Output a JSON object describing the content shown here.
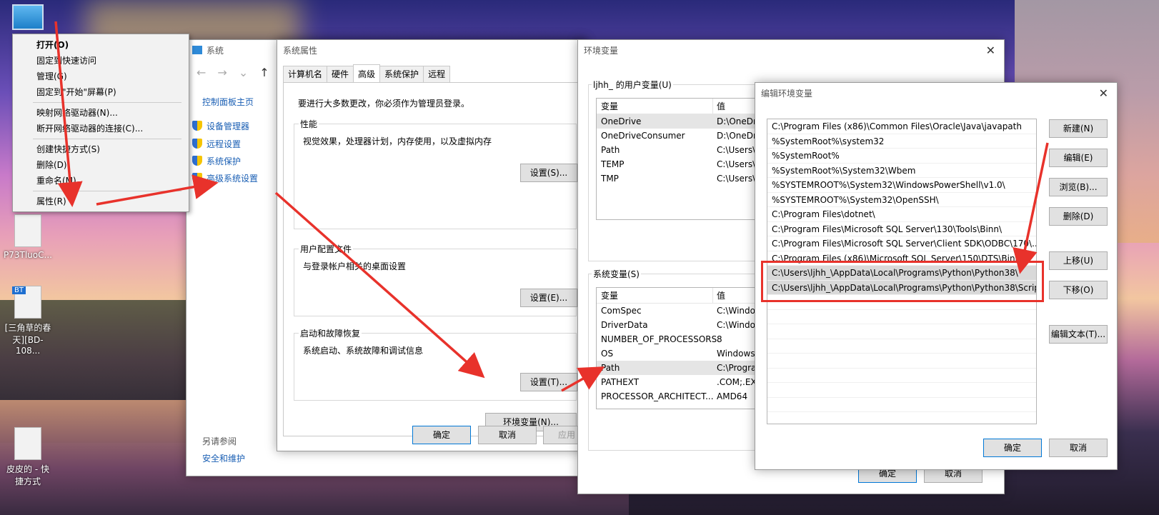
{
  "desktop": {
    "icons": [
      {
        "label": ""
      },
      {
        "label": "P73TluoC..."
      },
      {
        "label": "[三角草的春天][BD-108...",
        "badge": "BT"
      },
      {
        "label": "皮皮的 - 快捷方式"
      }
    ]
  },
  "context_menu": {
    "items": [
      {
        "label": "打开(O)",
        "bold": true
      },
      {
        "label": "固定到快速访问"
      },
      {
        "label": "管理(G)"
      },
      {
        "label": "固定到\"开始\"屏幕(P)"
      },
      {
        "sep": true
      },
      {
        "label": "映射网络驱动器(N)..."
      },
      {
        "label": "断开网络驱动器的连接(C)..."
      },
      {
        "sep": true
      },
      {
        "label": "创建快捷方式(S)"
      },
      {
        "label": "删除(D)"
      },
      {
        "label": "重命名(M)"
      },
      {
        "sep": true
      },
      {
        "label": "属性(R)"
      }
    ]
  },
  "system_window": {
    "title": "系统",
    "home_link": "控制面板主页",
    "links": [
      "设备管理器",
      "远程设置",
      "系统保护",
      "高级系统设置"
    ],
    "see_also": "另请参阅",
    "security": "安全和维护"
  },
  "sys_props": {
    "title": "系统属性",
    "tabs": [
      "计算机名",
      "硬件",
      "高级",
      "系统保护",
      "远程"
    ],
    "admin_note": "要进行大多数更改，你必须作为管理员登录。",
    "performance": {
      "title": "性能",
      "desc": "视觉效果，处理器计划，内存使用，以及虚拟内存",
      "button": "设置(S)..."
    },
    "profile": {
      "title": "用户配置文件",
      "desc": "与登录帐户相关的桌面设置",
      "button": "设置(E)..."
    },
    "startup": {
      "title": "启动和故障恢复",
      "desc": "系统启动、系统故障和调试信息",
      "button": "设置(T)..."
    },
    "env_button": "环境变量(N)...",
    "ok": "确定",
    "cancel": "取消",
    "apply": "应用(A)"
  },
  "env_vars": {
    "title": "环境变量",
    "user_section": "ljhh_ 的用户变量(U)",
    "col_var": "变量",
    "col_val": "值",
    "user_rows": [
      {
        "name": "OneDrive",
        "value": "D:\\OneDr"
      },
      {
        "name": "OneDriveConsumer",
        "value": "D:\\OneDr"
      },
      {
        "name": "Path",
        "value": "C:\\Users\\"
      },
      {
        "name": "TEMP",
        "value": "C:\\Users\\"
      },
      {
        "name": "TMP",
        "value": "C:\\Users\\"
      }
    ],
    "system_section": "系统变量(S)",
    "system_rows": [
      {
        "name": "ComSpec",
        "value": "C:\\Windo"
      },
      {
        "name": "DriverData",
        "value": "C:\\Windo"
      },
      {
        "name": "NUMBER_OF_PROCESSORS",
        "value": "8"
      },
      {
        "name": "OS",
        "value": "Windows_"
      },
      {
        "name": "Path",
        "value": "C:\\Progra"
      },
      {
        "name": "PATHEXT",
        "value": ".COM;.EX"
      },
      {
        "name": "PROCESSOR_ARCHITECT...",
        "value": "AMD64"
      }
    ],
    "ok": "确定",
    "cancel": "取消"
  },
  "edit_env": {
    "title": "编辑环境变量",
    "entries": [
      "C:\\Program Files (x86)\\Common Files\\Oracle\\Java\\javapath",
      "%SystemRoot%\\system32",
      "%SystemRoot%",
      "%SystemRoot%\\System32\\Wbem",
      "%SYSTEMROOT%\\System32\\WindowsPowerShell\\v1.0\\",
      "%SYSTEMROOT%\\System32\\OpenSSH\\",
      "C:\\Program Files\\dotnet\\",
      "C:\\Program Files\\Microsoft SQL Server\\130\\Tools\\Binn\\",
      "C:\\Program Files\\Microsoft SQL Server\\Client SDK\\ODBC\\170\\...",
      "C:\\Program Files (x86)\\Microsoft SQL Server\\150\\DTS\\Binn\\",
      "C:\\Users\\ljhh_\\AppData\\Local\\Programs\\Python\\Python38\\",
      "C:\\Users\\ljhh_\\AppData\\Local\\Programs\\Python\\Python38\\Scrip..."
    ],
    "buttons": [
      "新建(N)",
      "编辑(E)",
      "浏览(B)...",
      "删除(D)",
      "上移(U)",
      "下移(O)",
      "编辑文本(T)..."
    ],
    "ok": "确定",
    "cancel": "取消"
  },
  "colors": {
    "arrow": "#e8322b",
    "link": "#1a5fb4",
    "accent": "#0078d7"
  }
}
